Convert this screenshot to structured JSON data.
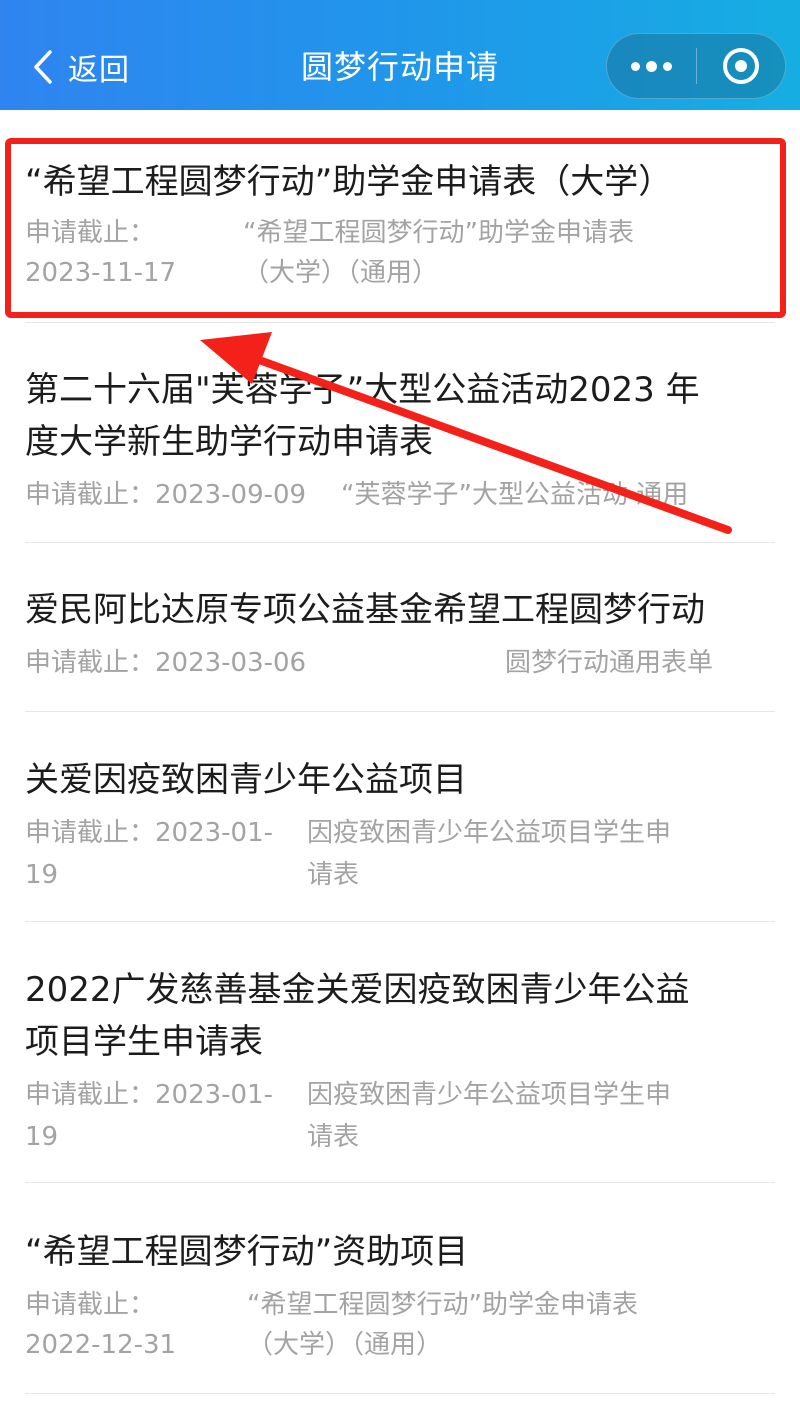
{
  "header": {
    "back_label": "返回",
    "title": "圆梦行动申请"
  },
  "items": [
    {
      "title": "“希望工程圆梦行动”助学金申请表（大学）",
      "deadline_label": "申请截止：",
      "deadline": "2023-11-17",
      "form_line1": "“希望工程圆梦行动”助学金申请表",
      "form_line2": "（大学）（通用）"
    },
    {
      "title_line1": "第二十六届\"芙蓉学子”大型公益活动2023 年",
      "title_line2": "度大学新生助学行动申请表",
      "deadline_text": "申请截止：2023-09-09",
      "form": "“芙蓉学子”大型公益活动·通用"
    },
    {
      "title": "爱民阿比达原专项公益基金希望工程圆梦行动",
      "deadline_text": "申请截止：2023-03-06",
      "form": "圆梦行动通用表单"
    },
    {
      "title": "关爱因疫致困青少年公益项目",
      "deadline_line1": "申请截止：2023-01-",
      "deadline_line2": "19",
      "form_line1": "因疫致困青少年公益项目学生申",
      "form_line2": "请表"
    },
    {
      "title_line1": "2022广发慈善基金关爱因疫致困青少年公益",
      "title_line2": "项目学生申请表",
      "deadline_line1": "申请截止：2023-01-",
      "deadline_line2": "19",
      "form_line1": "因疫致困青少年公益项目学生申",
      "form_line2": "请表"
    },
    {
      "title": "“希望工程圆梦行动”资助项目",
      "deadline_label": "申请截止：",
      "deadline": "2022-12-31",
      "form_line1": "“希望工程圆梦行动”助学金申请表",
      "form_line2": "（大学）（通用）"
    }
  ],
  "annotation": {
    "color": "#f4211a"
  },
  "icons": [
    "chevron-left-icon",
    "more-dots-icon",
    "close-target-icon"
  ]
}
